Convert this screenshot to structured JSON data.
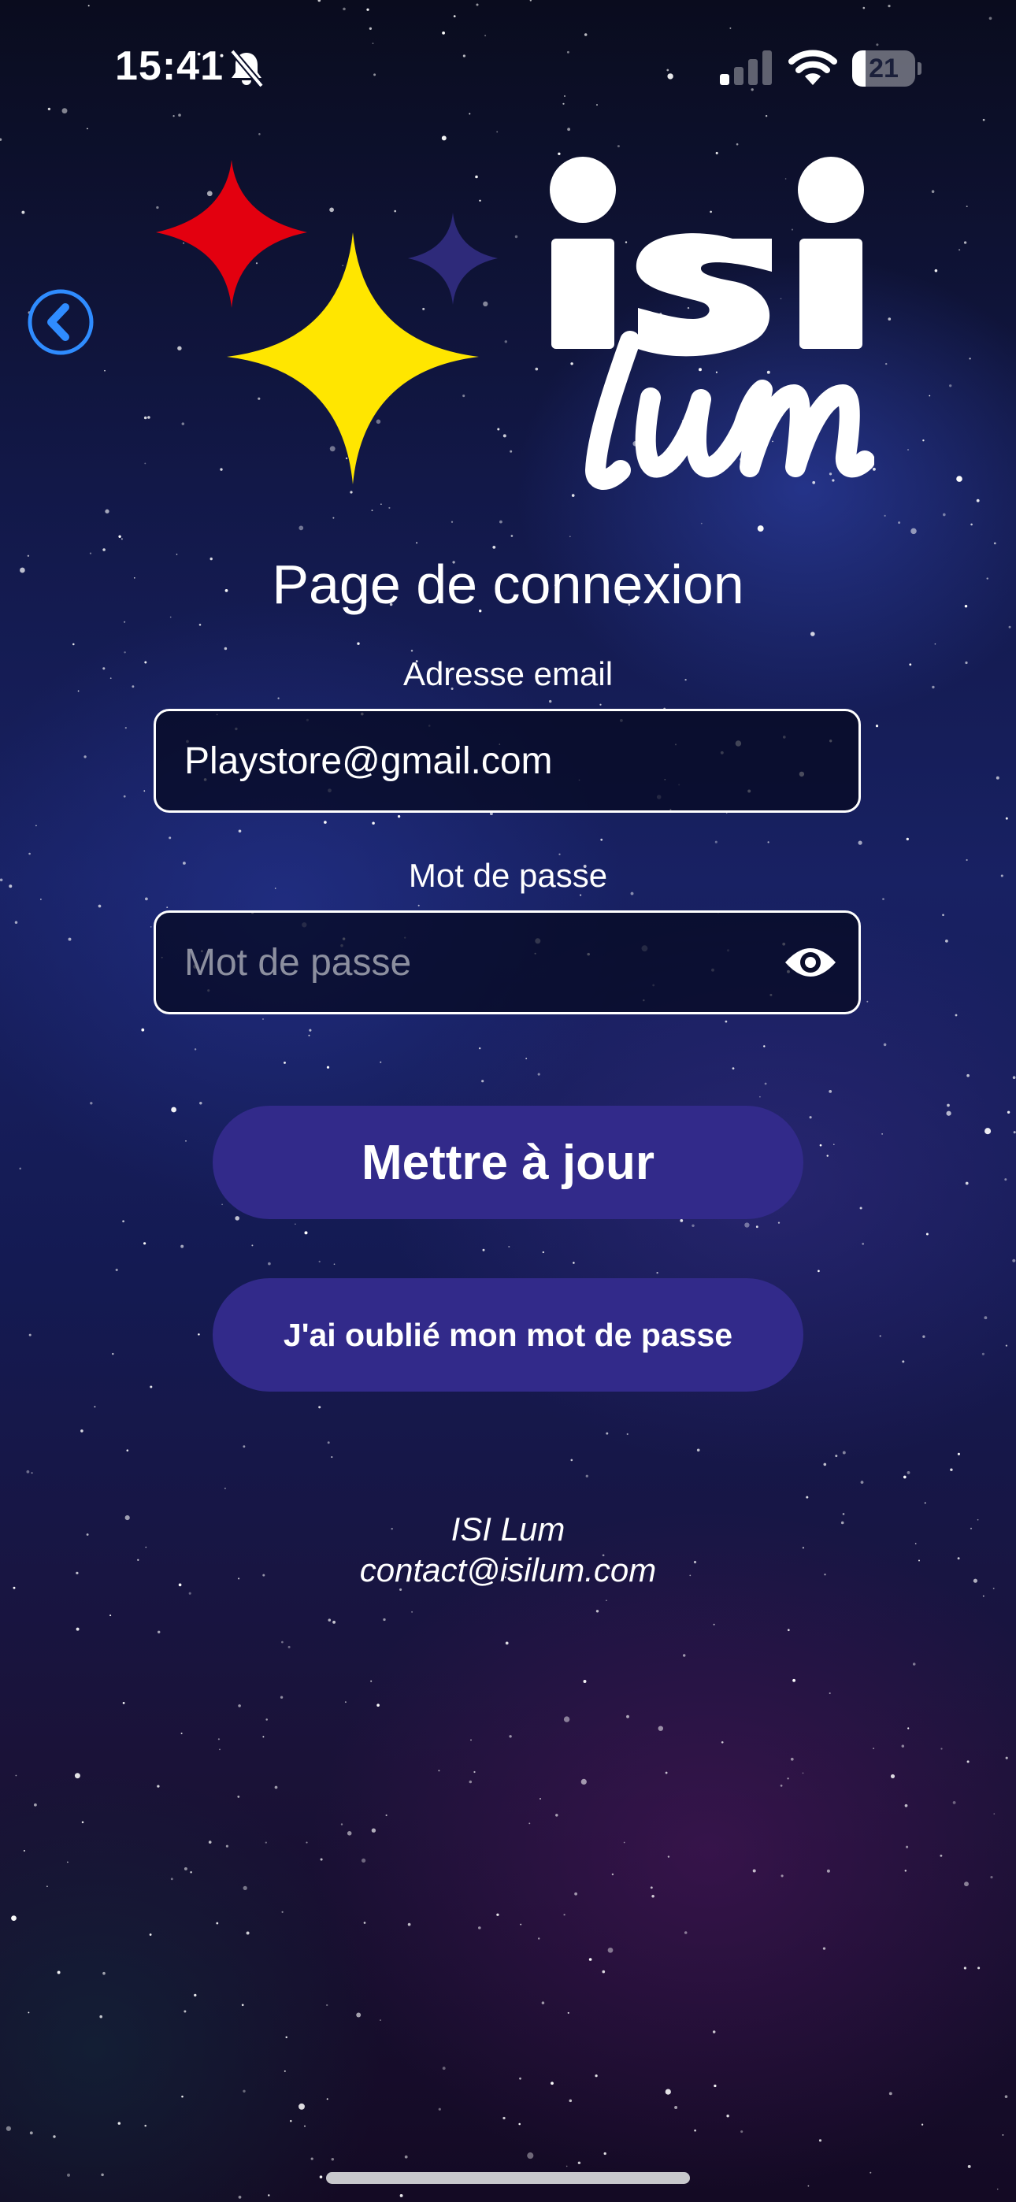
{
  "status_bar": {
    "time": "15:41",
    "silent_icon": "bell-slash-icon",
    "signal_icon": "cellular-signal-icon",
    "wifi_icon": "wifi-icon",
    "battery_level": "21",
    "battery_fraction": 0.21
  },
  "navigation": {
    "back_icon": "chevron-left-circle-icon"
  },
  "logo": {
    "brand_top": "isi",
    "brand_bottom": "lum",
    "star_colors": [
      "#e3000f",
      "#ffe600",
      "#2e2a7a"
    ]
  },
  "login": {
    "title": "Page de connexion",
    "email_label": "Adresse email",
    "email_value": "Playstore@gmail.com",
    "password_label": "Mot de passe",
    "password_value": "",
    "password_placeholder": "Mot de passe",
    "show_password_icon": "eye-icon",
    "update_button": "Mettre à jour",
    "forgot_button": "J'ai oublié mon mot de passe"
  },
  "footer": {
    "name": "ISI Lum",
    "email": "contact@isilum.com"
  },
  "colors": {
    "button_bg": "#322a8a",
    "back_button": "#2f8cff",
    "text": "#ffffff"
  }
}
